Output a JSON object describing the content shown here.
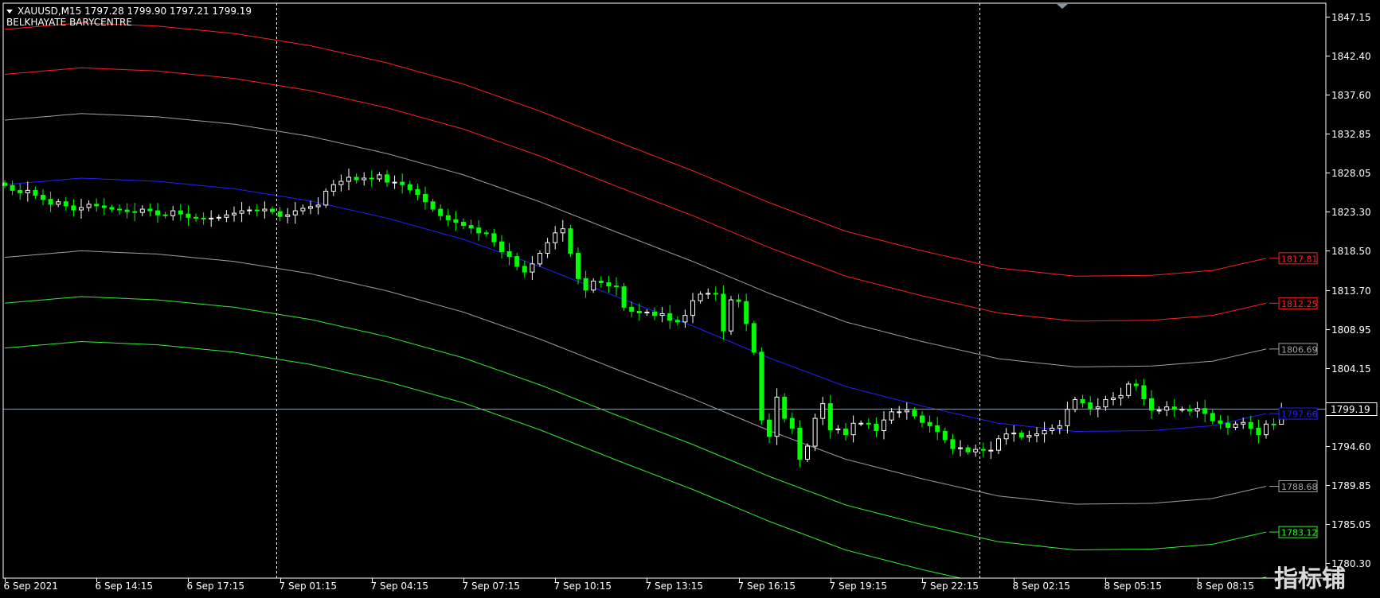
{
  "header": {
    "symbol_line": "XAUUSD,M15  1797.28 1799.90 1797.21 1799.19",
    "indicator_name": "BELKHAYATE BARYCENTRE"
  },
  "watermark": "指标铺",
  "chart_data": {
    "type": "candlestick",
    "symbol": "XAUUSD",
    "timeframe": "M15",
    "ohlc_last": {
      "open": 1797.28,
      "high": 1799.9,
      "low": 1797.21,
      "close": 1799.19
    },
    "current_price": 1799.19,
    "current_price_label": "1799.19",
    "ylim": [
      1780.3,
      1847.15
    ],
    "y_ticks": [
      "1847.15",
      "1842.40",
      "1837.60",
      "1832.85",
      "1828.05",
      "1823.30",
      "1818.50",
      "1813.70",
      "1808.95",
      "1804.15",
      "1799.19",
      "1794.60",
      "1789.85",
      "1785.05",
      "1780.30"
    ],
    "y_tick_values": [
      1847.15,
      1842.4,
      1837.6,
      1832.85,
      1828.05,
      1823.3,
      1818.5,
      1813.7,
      1808.95,
      1804.15,
      1799.19,
      1794.6,
      1789.85,
      1785.05,
      1780.3
    ],
    "x_ticks": [
      "6 Sep 2021",
      "6 Sep 14:15",
      "6 Sep 17:15",
      "7 Sep 01:15",
      "7 Sep 04:15",
      "7 Sep 07:15",
      "7 Sep 10:15",
      "7 Sep 13:15",
      "7 Sep 16:15",
      "7 Sep 19:15",
      "7 Sep 22:15",
      "8 Sep 02:15",
      "8 Sep 05:15",
      "8 Sep 08:15"
    ],
    "x_tick_index": [
      0,
      12,
      24,
      36,
      48,
      60,
      72,
      84,
      96,
      108,
      120,
      132,
      144,
      156
    ],
    "period_separators_index": [
      35,
      127
    ],
    "bars_count": 166,
    "closes": [
      1826.5,
      1825.9,
      1825.6,
      1825.9,
      1825.3,
      1824.8,
      1824.2,
      1824.5,
      1824.0,
      1823.5,
      1823.8,
      1824.2,
      1824.0,
      1823.8,
      1823.6,
      1823.5,
      1823.3,
      1823.2,
      1823.6,
      1823.4,
      1822.9,
      1822.8,
      1823.4,
      1823.0,
      1822.6,
      1822.5,
      1822.4,
      1822.5,
      1822.6,
      1822.9,
      1823.1,
      1823.4,
      1823.5,
      1823.4,
      1823.6,
      1823.3,
      1822.7,
      1822.9,
      1823.4,
      1823.7,
      1823.9,
      1824.1,
      1825.8,
      1826.6,
      1827.0,
      1827.5,
      1827.2,
      1827.4,
      1827.3,
      1827.8,
      1826.9,
      1826.9,
      1826.6,
      1826.0,
      1825.4,
      1824.5,
      1823.6,
      1822.8,
      1822.3,
      1822.0,
      1821.6,
      1821.3,
      1820.7,
      1820.6,
      1819.6,
      1818.4,
      1817.8,
      1816.6,
      1815.9,
      1816.9,
      1818.2,
      1819.5,
      1820.7,
      1821.2,
      1818.2,
      1815.1,
      1813.7,
      1814.8,
      1814.6,
      1814.2,
      1814.1,
      1811.6,
      1811.1,
      1810.9,
      1811.0,
      1810.6,
      1810.8,
      1810.0,
      1809.8,
      1810.6,
      1812.4,
      1813.2,
      1813.3,
      1813.2,
      1808.7,
      1812.5,
      1812.3,
      1809.6,
      1806.1,
      1797.8,
      1795.8,
      1800.6,
      1798.0,
      1796.8,
      1793.0,
      1794.6,
      1798.0,
      1799.8,
      1796.6,
      1796.7,
      1796.0,
      1797.4,
      1797.4,
      1797.3,
      1796.5,
      1797.8,
      1798.8,
      1798.8,
      1799.0,
      1798.3,
      1797.5,
      1797.1,
      1796.4,
      1795.4,
      1794.3,
      1794.4,
      1793.9,
      1794.2,
      1794.1,
      1794.1,
      1795.5,
      1796.1,
      1796.2,
      1795.7,
      1795.9,
      1796.1,
      1796.5,
      1796.8,
      1797.1,
      1799.1,
      1800.3,
      1799.9,
      1799.2,
      1799.4,
      1800.3,
      1800.5,
      1800.8,
      1802.2,
      1802.0,
      1800.4,
      1799.0,
      1799.0,
      1799.4,
      1799.1,
      1799.1,
      1798.9,
      1799.2,
      1798.6,
      1797.7,
      1797.4,
      1796.9,
      1797.3,
      1797.5,
      1796.8,
      1796.0,
      1797.3,
      1797.28,
      1799.19
    ],
    "opens_from_previous_close": true,
    "barycentre_lines": [
      {
        "name": "upper-2",
        "color": "#ff2020",
        "end_label": "1817.81"
      },
      {
        "name": "upper-1",
        "color": "#ff2020",
        "end_label": "1812.25"
      },
      {
        "name": "upper-0",
        "color": "#a0a0a0",
        "end_label": "1806.69"
      },
      {
        "name": "centre",
        "color": "#2020ff",
        "end_label": "1797.66"
      },
      {
        "name": "lower-0",
        "color": "#a0a0a0",
        "end_label": "1788.68"
      },
      {
        "name": "lower-1",
        "color": "#33ee33",
        "end_label": "1783.12"
      },
      {
        "name": "lower-2",
        "color": "#33ee33",
        "end_label": ""
      }
    ],
    "centre_curve": [
      [
        0,
        1826.6
      ],
      [
        10,
        1827.4
      ],
      [
        20,
        1827.0
      ],
      [
        30,
        1826.1
      ],
      [
        40,
        1824.6
      ],
      [
        50,
        1822.5
      ],
      [
        60,
        1819.9
      ],
      [
        70,
        1816.6
      ],
      [
        80,
        1812.9
      ],
      [
        90,
        1809.3
      ],
      [
        100,
        1805.4
      ],
      [
        110,
        1801.9
      ],
      [
        120,
        1799.5
      ],
      [
        130,
        1797.4
      ],
      [
        140,
        1796.4
      ],
      [
        150,
        1796.5
      ],
      [
        158,
        1797.1
      ],
      [
        166,
        1798.8
      ]
    ],
    "band_offsets": [
      19.0,
      13.5,
      7.9,
      0,
      -8.9,
      -14.5,
      -20.0
    ],
    "colors": {
      "background": "#000000",
      "axis": "#ffffff",
      "bull": "#ffffff",
      "bear": "#00ff00",
      "grid": "none"
    }
  }
}
